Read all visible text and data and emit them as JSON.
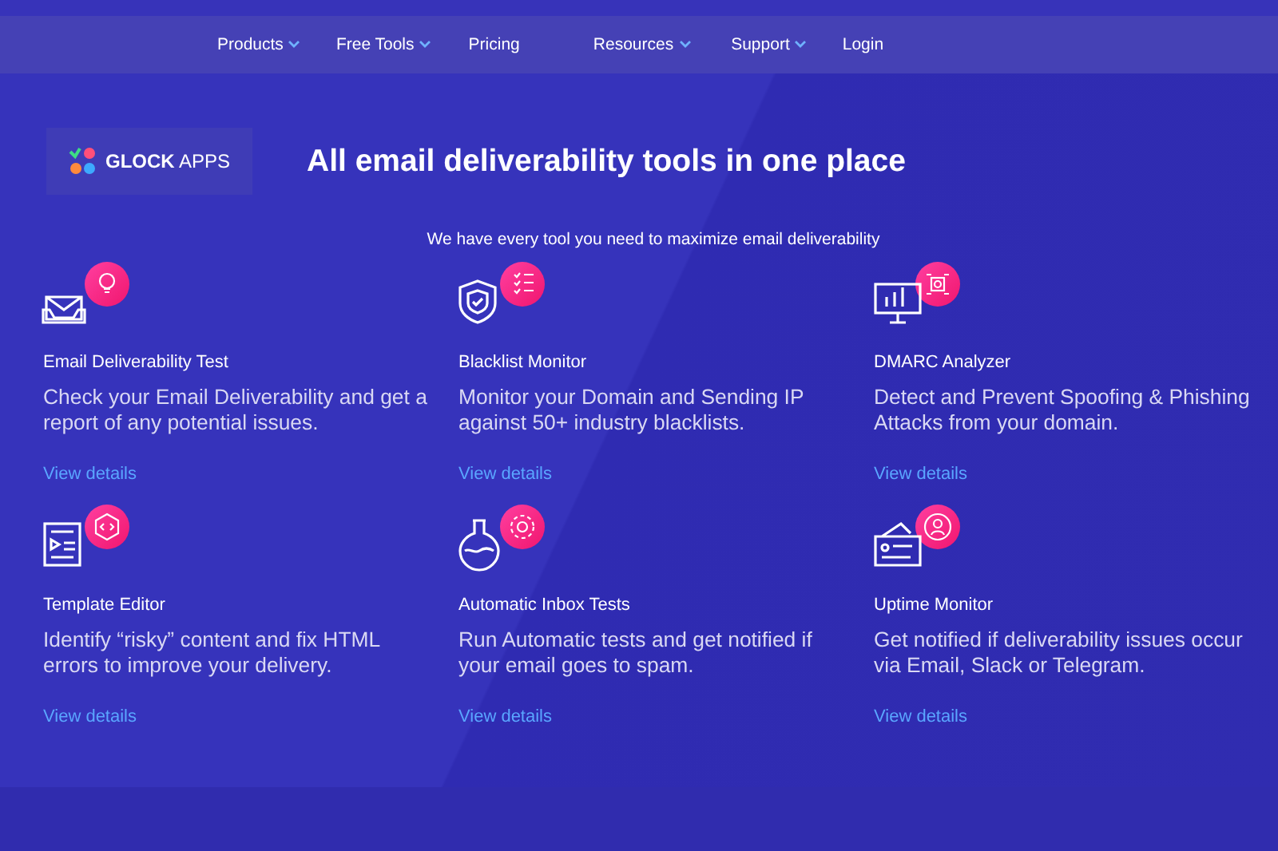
{
  "nav": [
    {
      "label": "Products",
      "dropdown": true
    },
    {
      "label": "Free Tools",
      "dropdown": true
    },
    {
      "label": "Pricing",
      "dropdown": false
    },
    {
      "label": "Resources",
      "dropdown": true
    },
    {
      "label": "Support",
      "dropdown": true
    },
    {
      "label": "Login",
      "dropdown": false
    }
  ],
  "logo": {
    "brand": "GLOCK",
    "suffix": "APPS"
  },
  "title": "All email deliverability tools in one place",
  "subtitle": "We have every tool you need to maximize email deliverability",
  "tools": [
    {
      "kind": "mail",
      "name": "Email Deliverability Test",
      "description": "Check your Email Deliverability and get a report of any potential issues.",
      "link": "View details"
    },
    {
      "kind": "shield",
      "name": "Blacklist Monitor",
      "description": "Monitor your Domain and Sending IP against 50+ industry blacklists.",
      "link": "View details"
    },
    {
      "kind": "monitor",
      "name": "DMARC Analyzer",
      "description": "Detect and Prevent Spoofing & Phishing Attacks from your domain.",
      "link": "View details"
    },
    {
      "kind": "template",
      "name": "Template Editor",
      "description": "Identify “risky” content and fix HTML errors to improve your delivery.",
      "link": "View details"
    },
    {
      "kind": "flask",
      "name": "Automatic Inbox Tests",
      "description": "Run Automatic tests and get notified if your email goes to spam.",
      "link": "View details"
    },
    {
      "kind": "card",
      "name": "Uptime Monitor",
      "description": "Get notified if deliverability issues occur via Email, Slack or Telegram.",
      "link": "View details"
    }
  ]
}
